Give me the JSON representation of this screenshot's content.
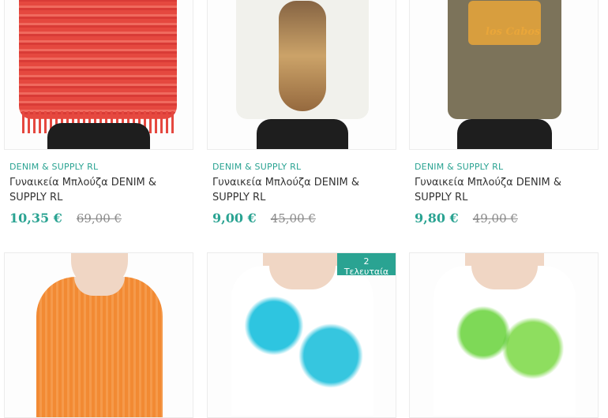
{
  "products": [
    {
      "brand": "DENIM & SUPPLY RL",
      "title": "Γυναικεία Μπλούζα DENIM & SUPPLY RL",
      "price": "10,35 €",
      "old_price": "69,00 €"
    },
    {
      "brand": "DENIM & SUPPLY RL",
      "title": "Γυναικεία Μπλούζα DENIM & SUPPLY RL",
      "price": "9,00 €",
      "old_price": "45,00 €"
    },
    {
      "brand": "DENIM & SUPPLY RL",
      "title": "Γυναικεία Μπλούζα DENIM & SUPPLY RL",
      "price": "9,80 €",
      "old_price": "49,00 €"
    }
  ],
  "graphic_text": "los Cabos",
  "badge": {
    "number": "2",
    "label": "Τελευταία"
  },
  "colors": {
    "accent": "#2aa392",
    "old_price": "#8a8a8a",
    "border": "#ececec"
  }
}
